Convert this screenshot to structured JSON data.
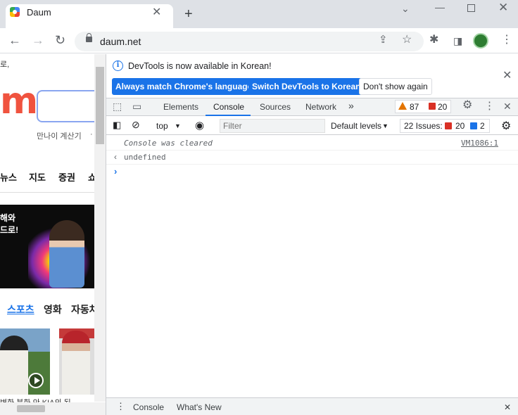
{
  "browser": {
    "tab_title": "Daum",
    "tab_close": "✕",
    "new_tab": "+",
    "url": "daum.net"
  },
  "page": {
    "top_text": "로,",
    "logo": "m",
    "age_calc": "만나이 계산기",
    "age_calc_more": "·",
    "nav": [
      "뉴스",
      "지도",
      "증권",
      "쇼"
    ],
    "banner_text": "해와\n드로!",
    "categories": [
      "스포츠",
      "영화",
      "자동차"
    ],
    "thumb_caption": "변화 분화 안   KIA의 된"
  },
  "devtools": {
    "info_text": "DevTools is now available in Korean!",
    "btn_match": "Always match Chrome's language",
    "btn_switch": "Switch DevTools to Korean",
    "btn_dont_show": "Don't show again",
    "tabs": [
      "Elements",
      "Console",
      "Sources",
      "Network"
    ],
    "more_tabs": "»",
    "warnings": "87",
    "errors": "20",
    "context": "top",
    "filter_placeholder": "Filter",
    "levels": "Default levels",
    "issues_label": "22 Issues:",
    "issues_errors": "20",
    "issues_info": "2",
    "messages": [
      {
        "text": "Console was cleared",
        "source": "VM1086:1"
      },
      {
        "text": "undefined"
      }
    ],
    "drawer_tabs": [
      "Console",
      "What's New"
    ]
  },
  "colors": {
    "accent": "#1a73e8",
    "daum_red": "#f0533f",
    "warning": "#e37400",
    "error": "#d93025"
  }
}
